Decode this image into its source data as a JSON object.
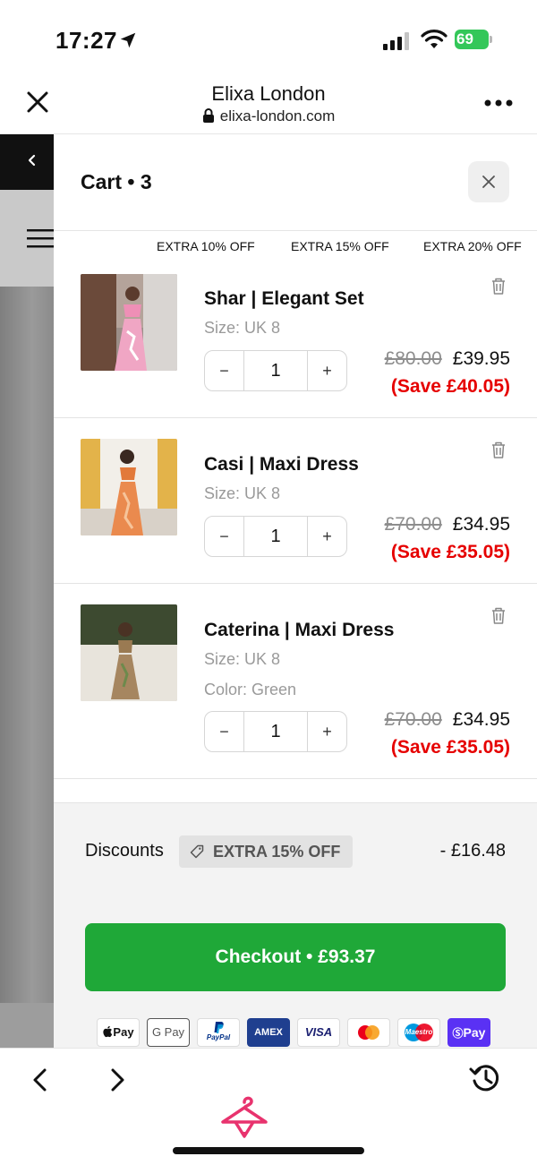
{
  "status_bar": {
    "time": "17:27",
    "battery": "69"
  },
  "browser": {
    "title": "Elixa London",
    "url": "elixa-london.com"
  },
  "cart": {
    "title": "Cart • 3",
    "promos": [
      "EXTRA 10% OFF",
      "EXTRA 15% OFF",
      "EXTRA 20% OFF"
    ],
    "stepper": {
      "minus": "−",
      "plus": "+"
    },
    "items": [
      {
        "name": "Shar | Elegant Set",
        "size": "Size: UK 8",
        "qty": "1",
        "old_price": "£80.00",
        "price": "£39.95",
        "save": "(Save £40.05)"
      },
      {
        "name": "Casi | Maxi Dress",
        "size": "Size: UK 8",
        "qty": "1",
        "old_price": "£70.00",
        "price": "£34.95",
        "save": "(Save £35.05)"
      },
      {
        "name": "Caterina | Maxi Dress",
        "size": "Size: UK 8",
        "color": "Color: Green",
        "qty": "1",
        "old_price": "£70.00",
        "price": "£34.95",
        "save": "(Save £35.05)"
      }
    ]
  },
  "summary": {
    "discounts_label": "Discounts",
    "discount_badge": "EXTRA 15% OFF",
    "discount_amount": "- £16.48",
    "checkout_label": "Checkout • £93.37"
  },
  "payment_methods": {
    "apple_pay": "Pay",
    "google_pay": "G Pay",
    "paypal": "PayPal",
    "amex": "AMEX",
    "visa": "VISA",
    "maestro": "Maestro",
    "shop_pay": "Pay"
  },
  "colors": {
    "checkout_green": "#1fa838",
    "save_red": "#e60000",
    "battery_green": "#34c759",
    "brand_pink": "#e8336e",
    "shop_pay_purple": "#5a31f4"
  }
}
